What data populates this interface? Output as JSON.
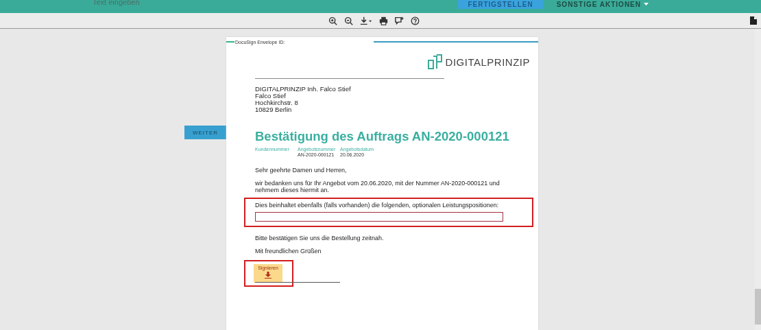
{
  "top_bar": {
    "search": {
      "placeholder": "Text eingeben"
    },
    "buttons": [
      {
        "label": "FERTIGSTELLEN",
        "kind": "primary"
      },
      {
        "label": "SONSTIGE AKTIONEN",
        "kind": "menu"
      }
    ]
  },
  "side": {
    "next_button": "WEITER"
  },
  "document": {
    "envelope_label": "DocuSign Envelope ID:",
    "logo_text": "DIGITALPRINZIP",
    "address": [
      "DIGITALPRINZIP Inh. Falco Stief",
      "Falco Stief",
      "Hochkirchstr. 8",
      "10829 Berlin"
    ],
    "title": "Bestätigung des Auftrags AN-2020-000121",
    "meta": [
      {
        "label": "Kundennummer"
      },
      {
        "label": "Angebotsnummer",
        "value": "AN-2020-000121"
      },
      {
        "label": "Angebotsdatum",
        "value": "20.06.2020"
      }
    ],
    "greeting": "Sehr geehrte Damen und Herren,",
    "intro": "wir bedanken uns für Ihr Angebot vom 20.06.2020, mit der Nummer AN-2020-000121 und nehmem dieses hiermit an.",
    "options_label": "Dies beinhaltet ebenfalls (falls vorhanden) die folgenden, optionalen Leistungspositionen:",
    "request": "Bitte bestätigen Sie uns die Bestellung zeitnah.",
    "closing": "Mit freundlichen Grüßen",
    "sign_button": "Signieren"
  }
}
